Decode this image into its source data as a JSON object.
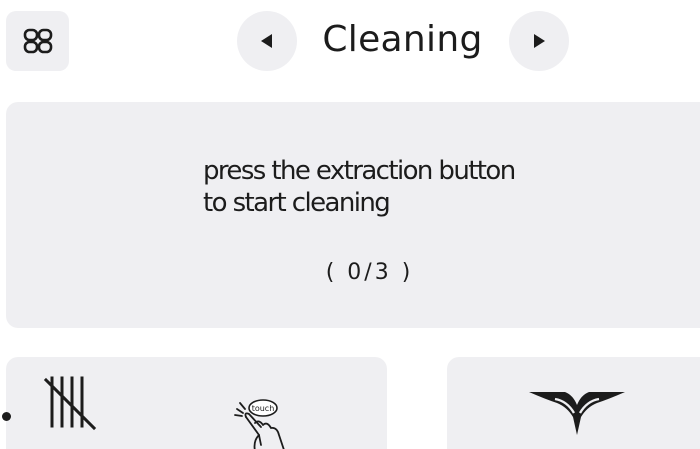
{
  "header": {
    "menu_icon": "grid-icon",
    "prev_icon": "triangle-left-icon",
    "next_icon": "triangle-right-icon",
    "title": "Cleaning"
  },
  "instruction": {
    "line1": "press the extraction button",
    "line2": "to start cleaning",
    "progress_text": "( 0/3 )",
    "progress": {
      "current": 0,
      "total": 3
    }
  },
  "bottom": {
    "steps_icon": "tally-marks-icon",
    "touch_icon": "touch-hand-icon",
    "touch_label": "touch",
    "brand_icon": "wing-logo-icon"
  },
  "colors": {
    "panel_background": "#efeff2",
    "text": "#1c1c1c",
    "page_background": "#ffffff"
  }
}
